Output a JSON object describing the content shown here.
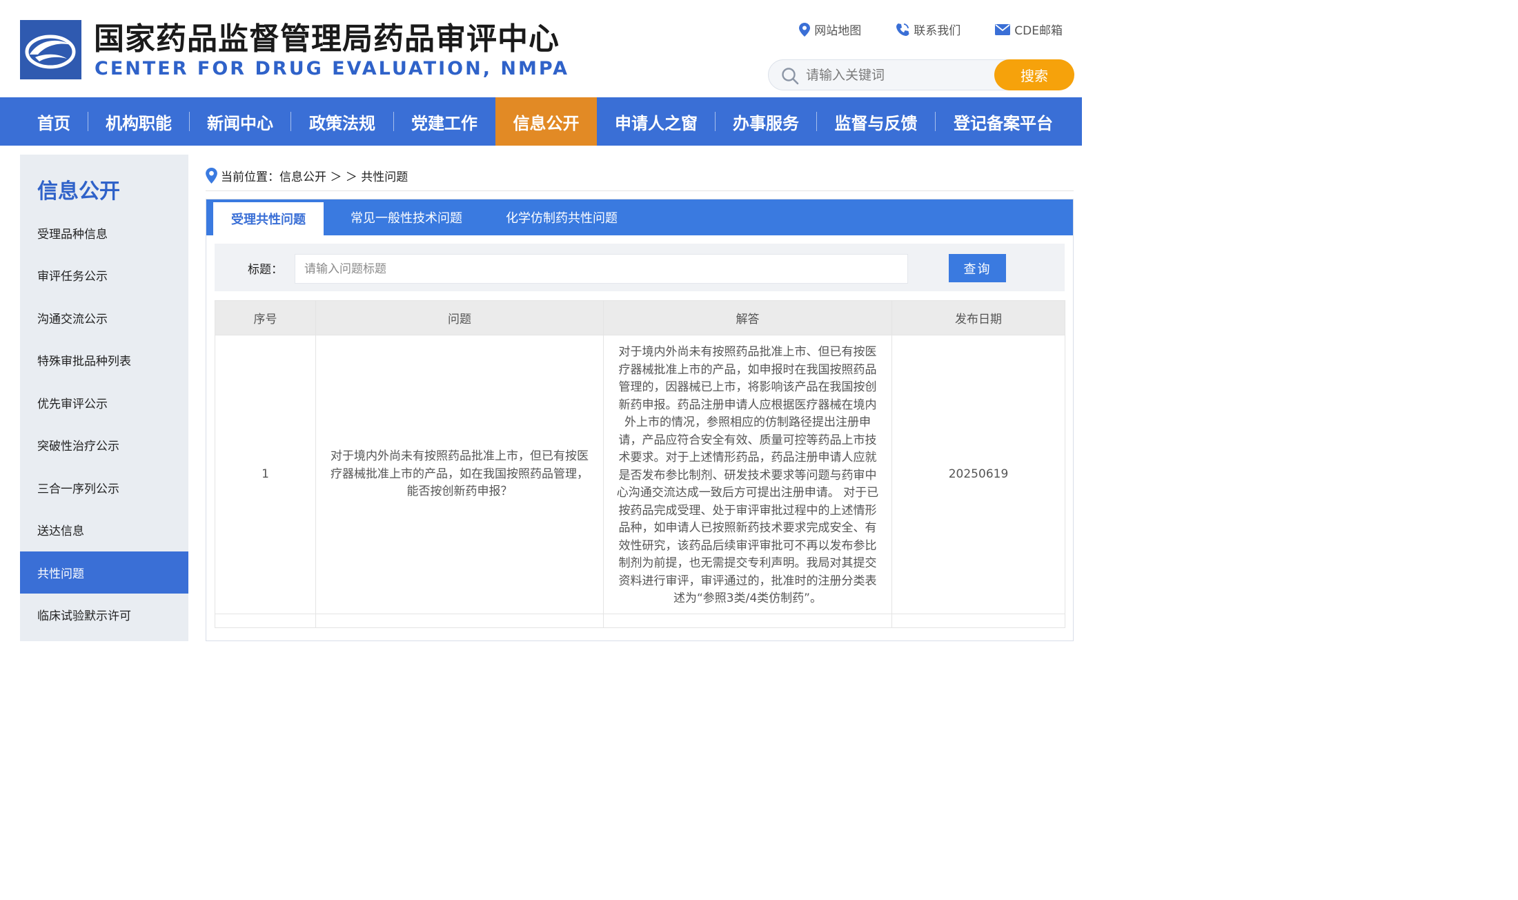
{
  "header": {
    "title_cn": "国家药品监督管理局药品审评中心",
    "title_en": "CENTER FOR DRUG EVALUATION, NMPA",
    "links": {
      "sitemap": "网站地图",
      "contact": "联系我们",
      "mail": "CDE邮箱"
    },
    "search": {
      "placeholder": "请输入关键词",
      "button": "搜索"
    }
  },
  "nav": {
    "items": [
      "首页",
      "机构职能",
      "新闻中心",
      "政策法规",
      "党建工作",
      "信息公开",
      "申请人之窗",
      "办事服务",
      "监督与反馈",
      "登记备案平台"
    ],
    "active": "信息公开"
  },
  "sidebar": {
    "title": "信息公开",
    "items": [
      "受理品种信息",
      "审评任务公示",
      "沟通交流公示",
      "特殊审批品种列表",
      "优先审评公示",
      "突破性治疗公示",
      "三合一序列公示",
      "送达信息",
      "共性问题",
      "临床试验默示许可"
    ],
    "active": "共性问题"
  },
  "breadcrumb": {
    "text": "当前位置：信息公开 ＞ ＞ 共性问题"
  },
  "tabs": {
    "items": [
      "受理共性问题",
      "常见一般性技术问题",
      "化学仿制药共性问题"
    ],
    "active": "受理共性问题"
  },
  "filter": {
    "label": "标题：",
    "placeholder": "请输入问题标题",
    "button": "查询"
  },
  "table": {
    "headers": [
      "序号",
      "问题",
      "解答",
      "发布日期"
    ],
    "rows": [
      {
        "index": "1",
        "question": "对于境内外尚未有按照药品批准上市，但已有按医疗器械批准上市的产品，如在我国按照药品管理，能否按创新药申报？",
        "answer": "对于境内外尚未有按照药品批准上市、但已有按医疗器械批准上市的产品，如申报时在我国按照药品管理的，因器械已上市，将影响该产品在我国按创新药申报。药品注册申请人应根据医疗器械在境内外上市的情况，参照相应的仿制路径提出注册申请，产品应符合安全有效、质量可控等药品上市技术要求。对于上述情形药品，药品注册申请人应就是否发布参比制剂、研发技术要求等问题与药审中心沟通交流达成一致后方可提出注册申请。 对于已按药品完成受理、处于审评审批过程中的上述情形品种，如申请人已按照新药技术要求完成安全、有效性研究，该药品后续审评审批可不再以发布参比制剂为前提，也无需提交专利声明。我局对其提交资料进行审评，审评通过的，批准时的注册分类表述为“参照3类/4类仿制药”。",
        "date": "20250619"
      }
    ]
  },
  "colors": {
    "primary": "#3a6fd6",
    "nav_active": "#e28a25",
    "search_button": "#f6a20b",
    "sidebar_bg": "#e9edf2"
  }
}
